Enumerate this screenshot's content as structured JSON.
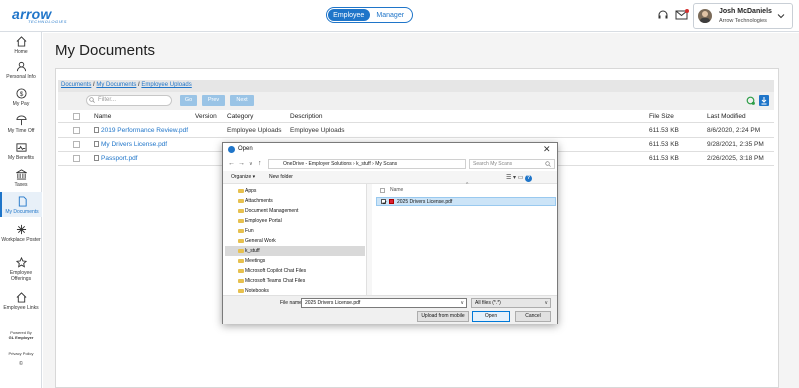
{
  "app": {
    "logo_text": "arrow",
    "logo_sub": "TECHNOLOGIES"
  },
  "header": {
    "roles": [
      "Employee",
      "Manager"
    ],
    "active_role": "Employee",
    "user_name": "Josh McDaniels",
    "user_company": "Arrow Technologies"
  },
  "sidebar": {
    "items": [
      {
        "label": "Home",
        "icon": "home-icon"
      },
      {
        "label": "Personal Info",
        "icon": "person-icon"
      },
      {
        "label": "My Pay",
        "icon": "dollar-icon"
      },
      {
        "label": "My Time Off",
        "icon": "beach-umbrella-icon"
      },
      {
        "label": "My Benefits",
        "icon": "heart-pulse-icon"
      },
      {
        "label": "Taxes",
        "icon": "bank-icon"
      },
      {
        "label": "My Documents",
        "icon": "document-icon"
      },
      {
        "label": "Workplace Poster",
        "icon": "poster-icon"
      },
      {
        "label": "Employee Offerings",
        "icon": "star-icon"
      },
      {
        "label": "Employee Links",
        "icon": "link-home-icon"
      }
    ],
    "active": "My Documents",
    "powered_by": "Powered By",
    "powered_brand": "GL Employer",
    "privacy": "Privacy Policy",
    "copyright": "©"
  },
  "main": {
    "title": "My Documents",
    "breadcrumb": [
      "Documents",
      "My Documents",
      "Employee Uploads"
    ],
    "filter_placeholder": "Filter...",
    "buttons": {
      "go": "Go",
      "prev": "Prev",
      "next": "Next"
    },
    "table": {
      "headers": [
        "Name",
        "Version",
        "Category",
        "Description",
        "File Size",
        "Last Modified"
      ],
      "rows": [
        {
          "name": "2019 Performance Review.pdf",
          "version": "",
          "category": "Employee Uploads",
          "description": "Employee Uploads",
          "size": "611.53 KB",
          "modified": "8/6/2020, 2:24 PM"
        },
        {
          "name": "My Drivers License.pdf",
          "version": "",
          "category": "",
          "description": "",
          "size": "611.53 KB",
          "modified": "9/28/2021, 2:35 PM"
        },
        {
          "name": "Passport.pdf",
          "version": "",
          "category": "",
          "description": "",
          "size": "611.53 KB",
          "modified": "2/26/2025, 3:18 PM"
        }
      ]
    }
  },
  "dialog": {
    "title": "Open",
    "path": [
      "OneDrive - Employer Solutions",
      "k_stuff",
      "My Scans"
    ],
    "search_placeholder": "Search My Scans",
    "organize": "Organize ▾",
    "new_folder": "New folder",
    "folders": [
      "Apps",
      "Attachments",
      "Document Management",
      "Employee Portal",
      "Fun",
      "General Work",
      "k_stuff",
      "Meetings",
      "Microsoft Copilot Chat Files",
      "Microsoft Teams Chat Files",
      "Notebooks"
    ],
    "selected_folder": "k_stuff",
    "column_name": "Name",
    "files": [
      "2025 Drivers License.pdf"
    ],
    "file_name_label": "File name:",
    "file_name_value": "2025 Drivers License.pdf",
    "file_type": "All files (*.*)",
    "buttons": {
      "upload": "Upload from mobile",
      "open": "Open",
      "cancel": "Cancel"
    }
  }
}
